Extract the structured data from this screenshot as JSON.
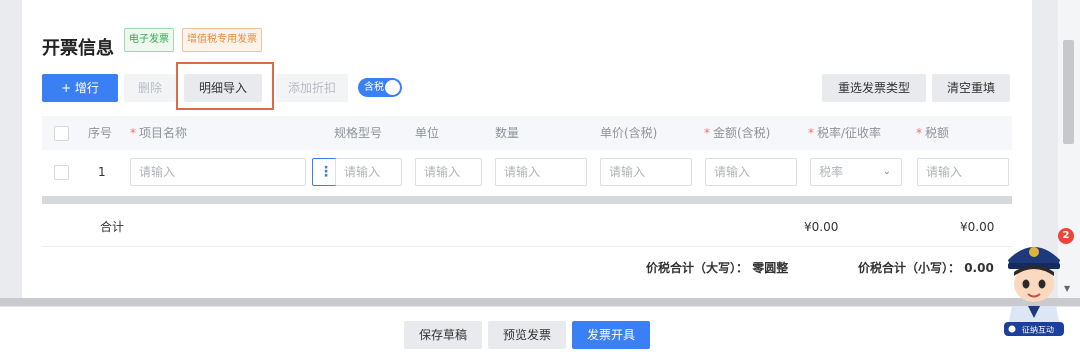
{
  "section": {
    "title": "开票信息",
    "tags": [
      "电子发票",
      "增值税专用发票"
    ]
  },
  "toolbar": {
    "add_row": "+ 增行",
    "delete": "删除",
    "import_detail": "明细导入",
    "add_discount": "添加折扣",
    "tax_toggle_label": "含税",
    "tax_toggle_on": true,
    "reselect_type": "重选发票类型",
    "clear_refill": "清空重填"
  },
  "table": {
    "headers": {
      "seq": "序号",
      "item_name": "项目名称",
      "spec": "规格型号",
      "unit": "单位",
      "qty": "数量",
      "unit_price": "单价(含税)",
      "amount": "金额(含税)",
      "tax_rate": "税率/征收率",
      "tax": "税额"
    },
    "row": {
      "seq": "1",
      "item_name_placeholder": "请输入",
      "spec_placeholder": "请输入",
      "unit_placeholder": "请输入",
      "qty_placeholder": "请输入",
      "price_placeholder": "请输入",
      "amount_placeholder": "请输入",
      "tax_rate_placeholder": "税率",
      "tax_placeholder": "请输入"
    },
    "summary": {
      "label": "合计",
      "amount": "¥0.00",
      "tax": "¥0.00"
    }
  },
  "totals": {
    "upper_label": "价税合计（大写）：",
    "upper_value": "零圆整",
    "lower_label": "价税合计（小写）：",
    "lower_value": "0.00"
  },
  "footer": {
    "save_draft": "保存草稿",
    "preview": "预览发票",
    "issue": "发票开具"
  },
  "assistant": {
    "badge_count": "2",
    "label": "征纳互动"
  },
  "colors": {
    "primary": "#3b7ff5",
    "required": "#f56c6c",
    "highlight_border": "#d96a4a"
  }
}
